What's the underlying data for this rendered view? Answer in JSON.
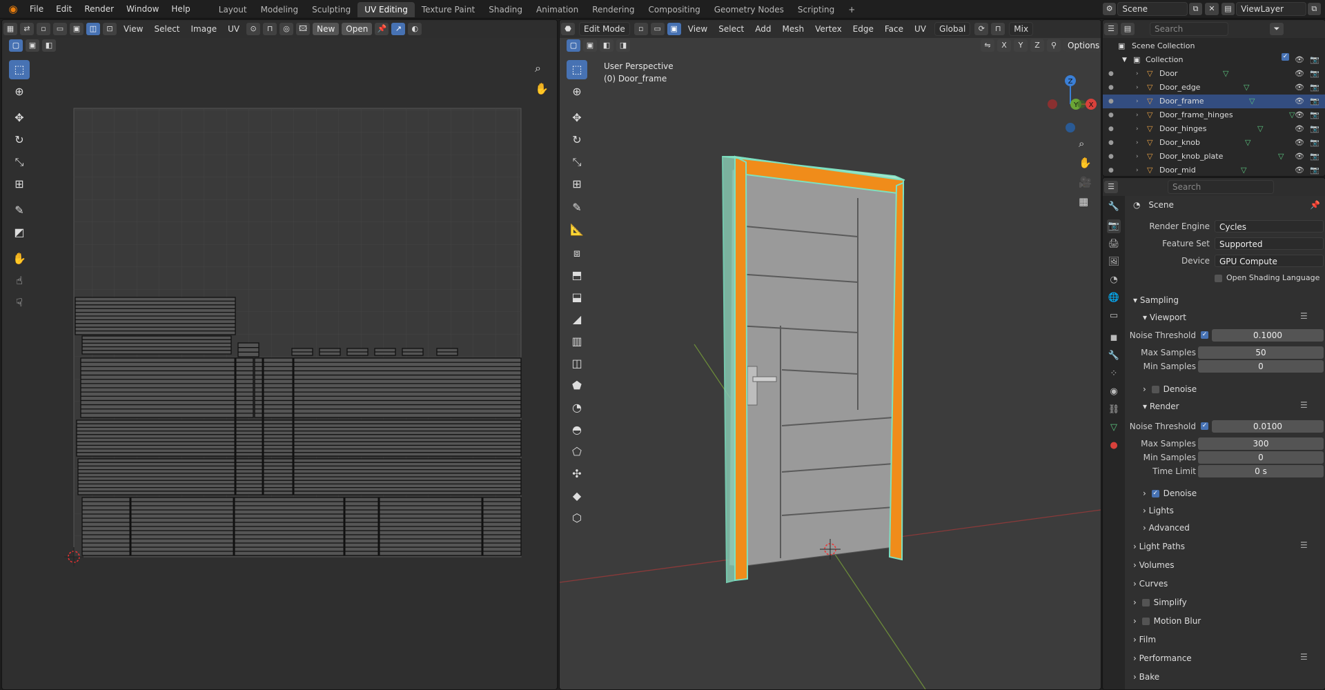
{
  "topbar": {
    "menus": [
      "File",
      "Edit",
      "Render",
      "Window",
      "Help"
    ],
    "workspaces": [
      "Layout",
      "Modeling",
      "Sculpting",
      "UV Editing",
      "Texture Paint",
      "Shading",
      "Animation",
      "Rendering",
      "Compositing",
      "Geometry Nodes",
      "Scripting"
    ],
    "active_workspace": "UV Editing",
    "add_tab": "+",
    "scene_name": "Scene",
    "view_layer": "ViewLayer"
  },
  "uv_editor": {
    "menus": [
      "View",
      "Select",
      "Image",
      "UV"
    ],
    "new_label": "New",
    "open_label": "Open"
  },
  "viewport": {
    "mode": "Edit Mode",
    "menus": [
      "View",
      "Select",
      "Add",
      "Mesh",
      "Vertex",
      "Edge",
      "Face",
      "UV"
    ],
    "orientation": "Global",
    "shading": "Mix",
    "options_label": "Options",
    "axes": [
      "X",
      "Y",
      "Z"
    ],
    "overlay_line1": "User Perspective",
    "overlay_line2": "(0) Door_frame",
    "gizmo": {
      "z": "Z",
      "y": "Y",
      "x": "X"
    }
  },
  "outliner": {
    "search_placeholder": "Search",
    "root": "Scene Collection",
    "collection": "Collection",
    "items": [
      {
        "name": "Door",
        "selected": false
      },
      {
        "name": "Door_edge",
        "selected": false
      },
      {
        "name": "Door_frame",
        "selected": true
      },
      {
        "name": "Door_frame_hinges",
        "selected": false
      },
      {
        "name": "Door_hinges",
        "selected": false
      },
      {
        "name": "Door_knob",
        "selected": false
      },
      {
        "name": "Door_knob_plate",
        "selected": false
      },
      {
        "name": "Door_mid",
        "selected": false
      }
    ]
  },
  "properties": {
    "search_placeholder": "Search",
    "context": "Scene",
    "render_engine_label": "Render Engine",
    "render_engine": "Cycles",
    "feature_set_label": "Feature Set",
    "feature_set": "Supported",
    "device_label": "Device",
    "device": "GPU Compute",
    "osl_label": "Open Shading Language",
    "sampling": "Sampling",
    "viewport": "Viewport",
    "noise_threshold_label": "Noise Threshold",
    "viewport_noise": "0.1000",
    "max_samples_label": "Max Samples",
    "min_samples_label": "Min Samples",
    "viewport_max": "50",
    "viewport_min": "0",
    "denoise": "Denoise",
    "render": "Render",
    "render_noise": "0.0100",
    "render_max": "300",
    "render_min": "0",
    "time_limit_label": "Time Limit",
    "time_limit": "0 s",
    "lights": "Lights",
    "advanced": "Advanced",
    "light_paths": "Light Paths",
    "volumes": "Volumes",
    "curves": "Curves",
    "simplify": "Simplify",
    "motion_blur": "Motion Blur",
    "film": "Film",
    "performance": "Performance",
    "bake": "Bake"
  }
}
